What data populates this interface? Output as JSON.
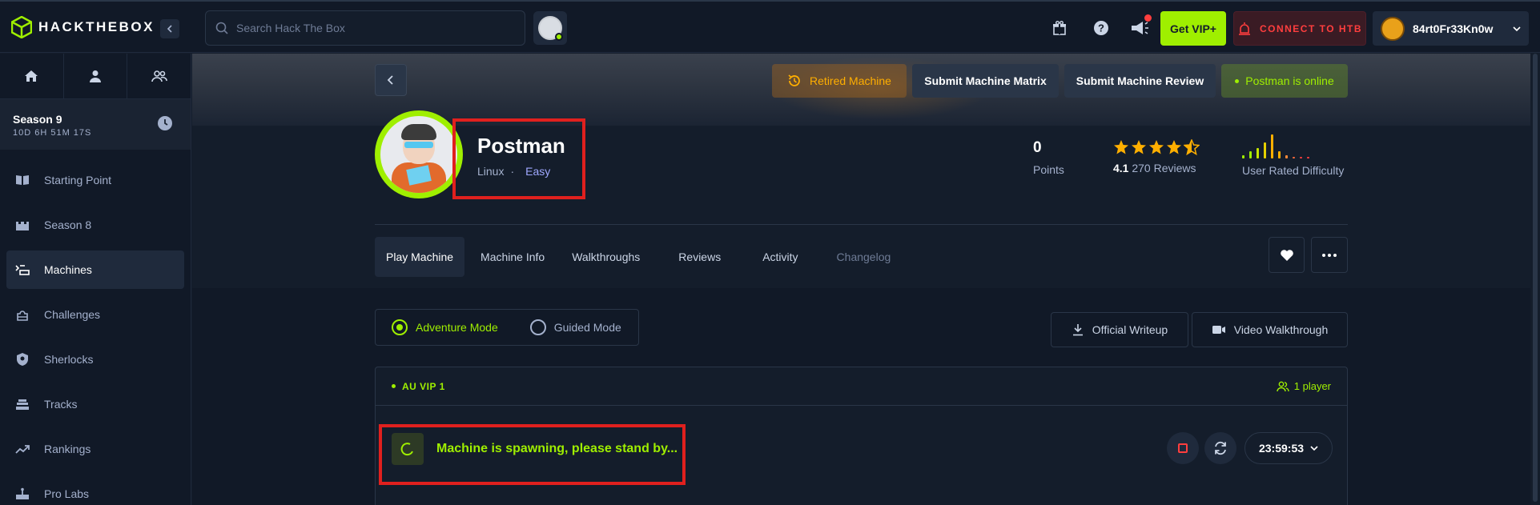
{
  "app": {
    "logo_text": "HACKTHEBOX"
  },
  "topbar": {
    "search_placeholder": "Search Hack The Box",
    "vip_label": "Get VIP+",
    "connect_label": "CONNECT TO HTB",
    "username": "84rt0Fr33Kn0w"
  },
  "sidebar": {
    "season": {
      "title": "Season 9",
      "countdown": "10D 6H 51M 17S"
    },
    "items": [
      {
        "label": "Starting Point"
      },
      {
        "label": "Season 8"
      },
      {
        "label": "Machines"
      },
      {
        "label": "Challenges"
      },
      {
        "label": "Sherlocks"
      },
      {
        "label": "Tracks"
      },
      {
        "label": "Rankings"
      },
      {
        "label": "Pro Labs"
      }
    ],
    "active_index": 2
  },
  "header": {
    "retired_label": "Retired Machine",
    "matrix_label": "Submit Machine Matrix",
    "review_label": "Submit Machine Review",
    "online_label": "Postman is online"
  },
  "machine": {
    "name": "Postman",
    "os": "Linux",
    "separator": "·",
    "difficulty": "Easy",
    "points_value": "0",
    "points_label": "Points",
    "rating": "4.1",
    "reviews": "270 Reviews",
    "difficulty_label": "User Rated Difficulty"
  },
  "tabs": [
    {
      "label": "Play Machine"
    },
    {
      "label": "Machine Info"
    },
    {
      "label": "Walkthroughs"
    },
    {
      "label": "Reviews"
    },
    {
      "label": "Activity"
    },
    {
      "label": "Changelog"
    }
  ],
  "modes": {
    "adventure_label": "Adventure Mode",
    "guided_label": "Guided Mode",
    "writeup_label": "Official Writeup",
    "video_label": "Video Walkthrough"
  },
  "vpn": {
    "server": "AU VIP 1",
    "players": "1 player",
    "status_text": "Machine is spawning, please stand by...",
    "timer": "23:59:53"
  },
  "colors": {
    "accent": "#9fef00",
    "background": "#141d2b",
    "panel": "#111927",
    "danger": "#ff3e3e",
    "retired": "#ffaf00",
    "highlight_box": "#e0201e"
  }
}
